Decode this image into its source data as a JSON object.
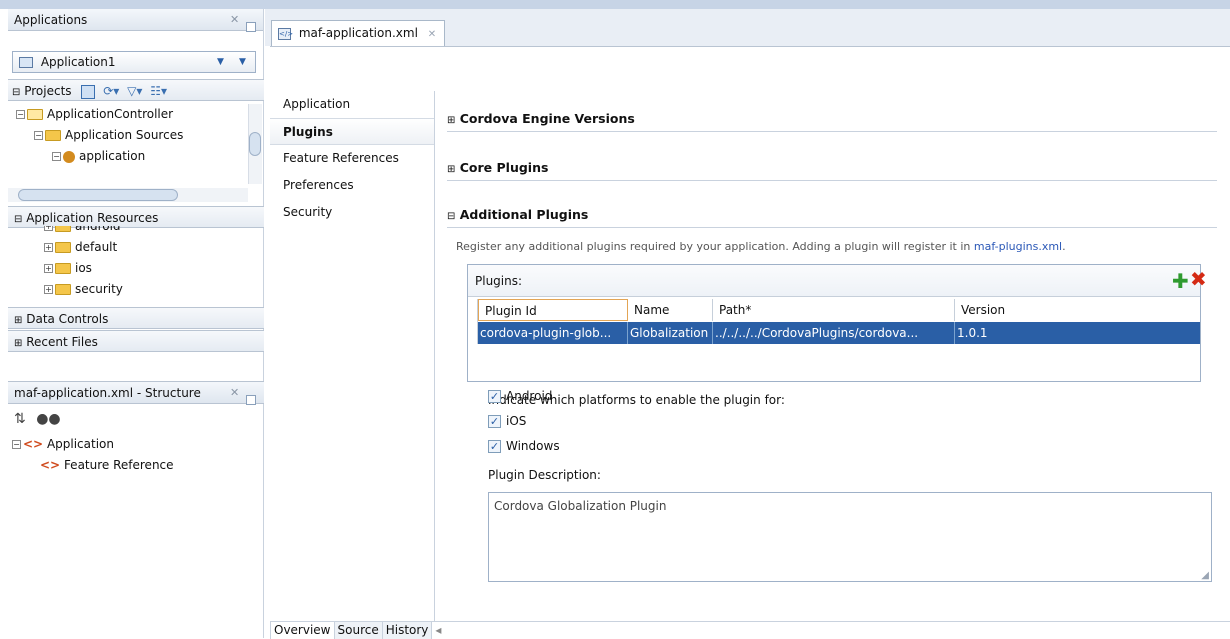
{
  "applications_panel": {
    "title": "Applications",
    "app_selector_value": "Application1",
    "projects_label": "Projects",
    "tree": [
      "ApplicationController",
      "Application Sources",
      "application"
    ],
    "resources_header": "Application Resources",
    "resources": [
      "android",
      "default",
      "ios",
      "security"
    ],
    "data_controls": "Data Controls",
    "recent_files": "Recent Files"
  },
  "structure_panel": {
    "title": "maf-application.xml - Structure",
    "tree": [
      "Application",
      "Feature Reference"
    ]
  },
  "editor_tab": {
    "label": "maf-application.xml"
  },
  "nav": {
    "items": [
      "Application",
      "Plugins",
      "Feature References",
      "Preferences",
      "Security"
    ],
    "selected": "Plugins"
  },
  "sections": {
    "cordova": "Cordova Engine Versions",
    "core": "Core Plugins",
    "additional": "Additional Plugins"
  },
  "additional": {
    "help_text": "Register any additional plugins required by your application. Adding a plugin will register it in ",
    "help_link": "maf-plugins.xml",
    "help_end": ".",
    "plugins_label": "Plugins:",
    "columns": [
      "Plugin Id",
      "Name",
      "Path*",
      "Version"
    ],
    "rows": [
      {
        "id": "cordova-plugin-glob...",
        "name": "Globalization",
        "path": "../../../../CordovaPlugins/cordova...",
        "version": "1.0.1"
      }
    ],
    "platforms_label": "Indicate which platforms to enable the plugin for:",
    "platforms": [
      {
        "label": "Android",
        "checked": true
      },
      {
        "label": "iOS",
        "checked": true
      },
      {
        "label": "Windows",
        "checked": true
      }
    ],
    "description_label": "Plugin Description:",
    "description_value": "Cordova Globalization Plugin"
  },
  "bottom_tabs": [
    "Overview",
    "Source",
    "History"
  ],
  "colors": {
    "selection": "#2a5fa6",
    "link": "#2b58b7",
    "panel_header": "#dfe6ef"
  }
}
